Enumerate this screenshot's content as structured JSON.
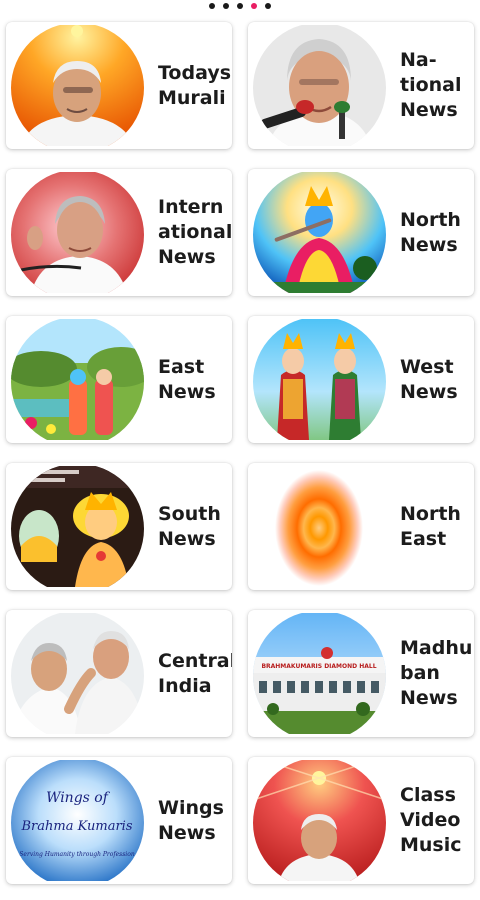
{
  "pager": {
    "pages": 5,
    "active_index": 3
  },
  "colors": {
    "active_dot": "#e91e63",
    "dot": "#1a1a1a",
    "text": "#1c1c1c"
  },
  "tiles": [
    {
      "label": "Todays\nMurali",
      "image": "speaker-portrait-orange"
    },
    {
      "label": "Na-\ntional\nNews",
      "image": "speaker-portrait-microphone"
    },
    {
      "label": "Intern\national\nNews",
      "image": "speaker-portrait-red"
    },
    {
      "label": "North\nNews",
      "image": "deity-flute-blue"
    },
    {
      "label": "East\nNews",
      "image": "deities-garden"
    },
    {
      "label": "West\nNews",
      "image": "deities-crowned"
    },
    {
      "label": "South\nNews",
      "image": "child-deity-poster"
    },
    {
      "label": "North\nEast",
      "image": "orange-light-oval"
    },
    {
      "label": "Central\nIndia",
      "image": "two-elders-greeting"
    },
    {
      "label": "Madhu\nban\nNews",
      "image": "building-diamond-hall"
    },
    {
      "label": "Wings\nNews",
      "image": "wings-of-brahma-kumaris-logo"
    },
    {
      "label": "Class\nVideo\nMusic",
      "image": "speaker-portrait-orange"
    }
  ],
  "logo_text": {
    "line1": "Wings of",
    "line2": "Brahma Kumaris",
    "line3": "Serving Humanity through Profession"
  },
  "building_sign": "BRAHMAKUMARIS DIAMOND HALL"
}
